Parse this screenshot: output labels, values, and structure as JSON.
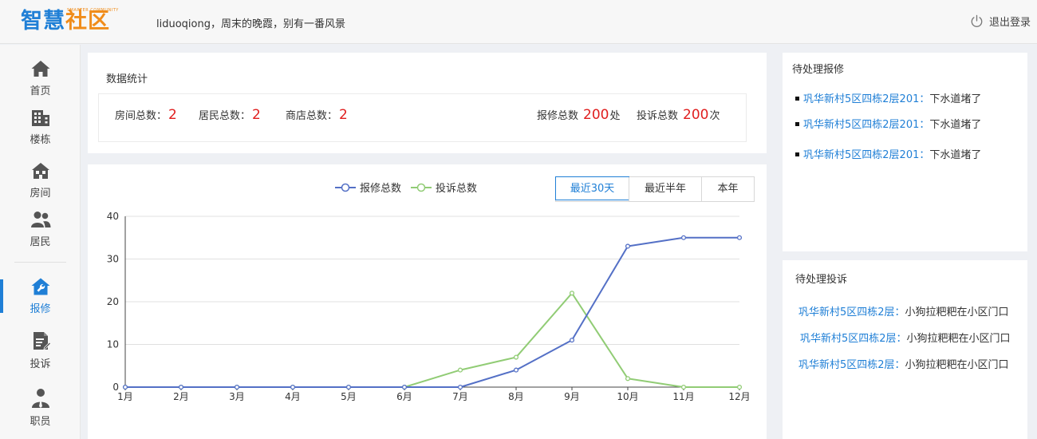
{
  "header": {
    "logo_main_part1": "智慧",
    "logo_main_part2": "社区",
    "logo_sub": "SMARTER COMMUNITY",
    "greeting": "liduoqiong，周末的晚霞，别有一番风景",
    "logout_label": "退出登录",
    "logout_icon": "power-icon"
  },
  "sidebar": {
    "items": [
      {
        "label": "首页",
        "icon": "home-icon"
      },
      {
        "label": "楼栋",
        "icon": "building-icon"
      },
      {
        "label": "房间",
        "icon": "house-icon"
      },
      {
        "label": "居民",
        "icon": "people-icon"
      },
      {
        "label": "报修",
        "icon": "repair-icon",
        "active": true
      },
      {
        "label": "投诉",
        "icon": "complaint-icon"
      },
      {
        "label": "职员",
        "icon": "staff-icon"
      }
    ]
  },
  "stats": {
    "title": "数据统计",
    "rooms_label": "房间总数：",
    "rooms_value": "2",
    "residents_label": "居民总数：",
    "residents_value": "2",
    "shops_label": "商店总数：",
    "shops_value": "2",
    "repairs_label": "报修总数",
    "repairs_value": "200",
    "repairs_unit": "处",
    "complaints_label": "投诉总数",
    "complaints_value": "200",
    "complaints_unit": "次"
  },
  "range_tabs": [
    {
      "label": "最近30天",
      "active": true
    },
    {
      "label": "最近半年",
      "active": false
    },
    {
      "label": "本年",
      "active": false
    }
  ],
  "colors": {
    "accent": "#1f7fd6",
    "repair_series": "#5470c6",
    "complaint_series": "#91cc75",
    "stat_number": "#e01e1e"
  },
  "chart_data": {
    "type": "line",
    "categories": [
      "1月",
      "2月",
      "3月",
      "4月",
      "5月",
      "6月",
      "7月",
      "8月",
      "9月",
      "10月",
      "11月",
      "12月"
    ],
    "series": [
      {
        "name": "报修总数",
        "values": [
          0,
          0,
          0,
          0,
          0,
          0,
          0,
          4,
          11,
          33,
          35,
          35
        ]
      },
      {
        "name": "投诉总数",
        "values": [
          0,
          0,
          0,
          0,
          0,
          0,
          4,
          7,
          22,
          2,
          0,
          0
        ]
      }
    ],
    "ylim": [
      0,
      40
    ],
    "yticks": [
      0,
      10,
      20,
      30,
      40
    ],
    "grid": true,
    "legend": "top-center"
  },
  "pending_repairs": {
    "title": "待处理报修",
    "items": [
      {
        "location": "巩华新村5区四栋2层201：",
        "issue": "下水道堵了"
      },
      {
        "location": "巩华新村5区四栋2层201：",
        "issue": "下水道堵了"
      },
      {
        "location": "巩华新村5区四栋2层201：",
        "issue": "下水道堵了"
      }
    ]
  },
  "pending_complaints": {
    "title": "待处理投诉",
    "items": [
      {
        "location": "巩华新村5区四栋2层：",
        "issue": "小狗拉粑粑在小区门口"
      },
      {
        "location": "巩华新村5区四栋2层：",
        "issue": "小狗拉粑粑在小区门口"
      },
      {
        "location": "巩华新村5区四栋2层：",
        "issue": "小狗拉粑粑在小区门口"
      }
    ]
  }
}
